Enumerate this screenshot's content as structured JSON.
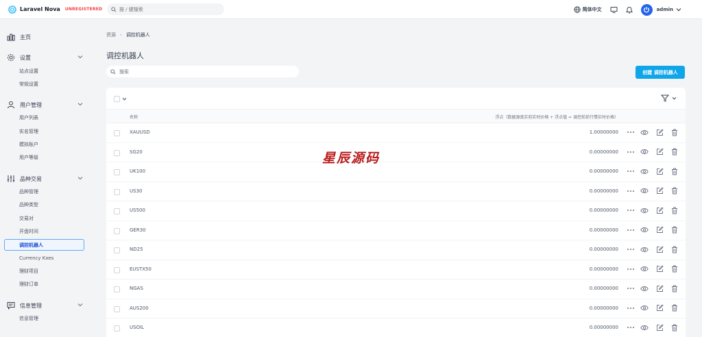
{
  "header": {
    "logo_text": "Laravel Nova",
    "badge": "UNREGISTERED",
    "search_placeholder": "按 / 键搜索",
    "language": "简体中文",
    "user_name": "admin"
  },
  "sidebar": {
    "sections": [
      {
        "label": "主页",
        "icon": "dashboard-icon",
        "items": []
      },
      {
        "label": "设置",
        "icon": "gear-icon",
        "items": [
          "站点设置",
          "常规设置"
        ]
      },
      {
        "label": "用户管理",
        "icon": "users-icon",
        "items": [
          "用户列表",
          "实名管理",
          "模拟账户",
          "用户等级"
        ]
      },
      {
        "label": "品种交易",
        "icon": "sliders-icon",
        "items": [
          "品种管理",
          "品种类型",
          "交易对",
          "开盘时间",
          "调控机器人",
          "Currency Kxes",
          "理财项目",
          "理财订单"
        ]
      },
      {
        "label": "信息管理",
        "icon": "chat-icon",
        "items": [
          "信息管理"
        ]
      }
    ],
    "active_item": "调控机器人"
  },
  "breadcrumb": {
    "root": "资源",
    "current": "调控机器人"
  },
  "page": {
    "title": "调控机器人",
    "search_placeholder": "搜索",
    "create_label": "创建 调控机器人"
  },
  "table": {
    "columns": [
      "名称",
      "浮点（数据源真实前实时价格 + 浮点值 = 调控前前行情实时价格）"
    ],
    "rows": [
      {
        "name": "XAUUSD",
        "value": "1.00000000"
      },
      {
        "name": "SG20",
        "value": "0.00000000"
      },
      {
        "name": "UK100",
        "value": "0.00000000"
      },
      {
        "name": "US30",
        "value": "0.00000000"
      },
      {
        "name": "US500",
        "value": "0.00000000"
      },
      {
        "name": "GER30",
        "value": "0.00000000"
      },
      {
        "name": "ND25",
        "value": "0.00000000"
      },
      {
        "name": "EUSTX50",
        "value": "0.00000000"
      },
      {
        "name": "NGAS",
        "value": "0.00000000"
      },
      {
        "name": "AUS200",
        "value": "0.00000000"
      },
      {
        "name": "USOIL",
        "value": "0.00000000"
      }
    ]
  },
  "watermark": "星辰源码",
  "colors": {
    "accent": "#0ea5e9",
    "brand": "#2563eb",
    "badge": "#ef4444",
    "watermark": "#b91c1c"
  }
}
